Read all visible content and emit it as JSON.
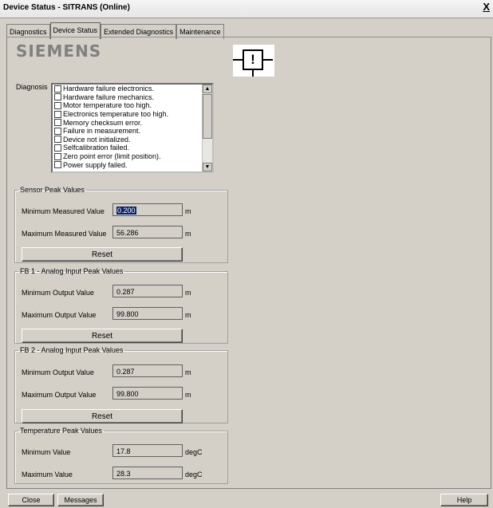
{
  "window": {
    "title": "Device Status - SITRANS  (Online)",
    "close_label": "X"
  },
  "tabs": [
    "Diagnostics",
    "Device Status",
    "Extended Diagnostics",
    "Maintenance"
  ],
  "active_tab": "Device Status",
  "logo": "SIEMENS",
  "status_icon": "maintenance-alarm-icon",
  "diagnosis": {
    "label": "Diagnosis",
    "items": [
      "Hardware failure electronics.",
      "Hardware failure mechanics.",
      "Motor temperature too high.",
      "Electronics temperature too high.",
      "Memory checksum error.",
      "Failure in measurement.",
      "Device not initialized.",
      "Selfcalibration failed.",
      "Zero point error (limit position).",
      "Power supply failed."
    ]
  },
  "sensor_peak": {
    "legend": "Sensor Peak Values",
    "min_label": "Minimum Measured Value",
    "min_value": "0.200",
    "min_unit": "m",
    "max_label": "Maximum Measured Value",
    "max_value": "56.286",
    "max_unit": "m",
    "reset_label": "Reset"
  },
  "fb1": {
    "legend": "FB 1 - Analog Input Peak Values",
    "min_label": "Minimum Output Value",
    "min_value": "0.287",
    "min_unit": "m",
    "max_label": "Maximum Output Value",
    "max_value": "99.800",
    "max_unit": "m",
    "reset_label": "Reset"
  },
  "fb2": {
    "legend": "FB 2 - Analog Input Peak Values",
    "min_label": "Minimum Output Value",
    "min_value": "0.287",
    "min_unit": "m",
    "max_label": "Maximum Output Value",
    "max_value": "99.800",
    "max_unit": "m",
    "reset_label": "Reset"
  },
  "temperature_peak": {
    "legend": "Temperature Peak Values",
    "min_label": "Minimum Value",
    "min_value": "17.8",
    "min_unit": "degC",
    "max_label": "Maximum Value",
    "max_value": "28.3",
    "max_unit": "degC"
  },
  "footer": {
    "close_label": "Close",
    "messages_label": "Messages",
    "help_label": "Help"
  }
}
